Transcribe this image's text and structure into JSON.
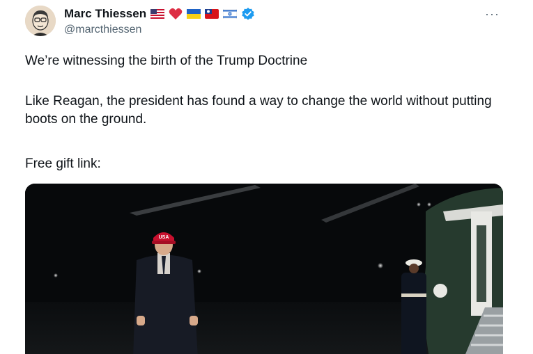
{
  "author": {
    "name": "Marc Thiessen",
    "handle": "@marcthiessen",
    "verified": true,
    "name_emojis": [
      "us-flag-emoji",
      "red-heart-emoji",
      "ukraine-flag-emoji",
      "taiwan-flag-emoji",
      "israel-flag-emoji"
    ]
  },
  "menu": {
    "more_label": "···"
  },
  "tweet": {
    "line1": "We’re witnessing the birth of the Trump Doctrine",
    "line2": "Like Reagan, the president has found a way to change the world without putting boots on the ground.",
    "line3": "Free gift link:"
  },
  "media": {
    "hat_text": "USA",
    "colors": {
      "hat": "#c8102e",
      "verified": "#1d9bf0",
      "background": "#07090b"
    }
  }
}
